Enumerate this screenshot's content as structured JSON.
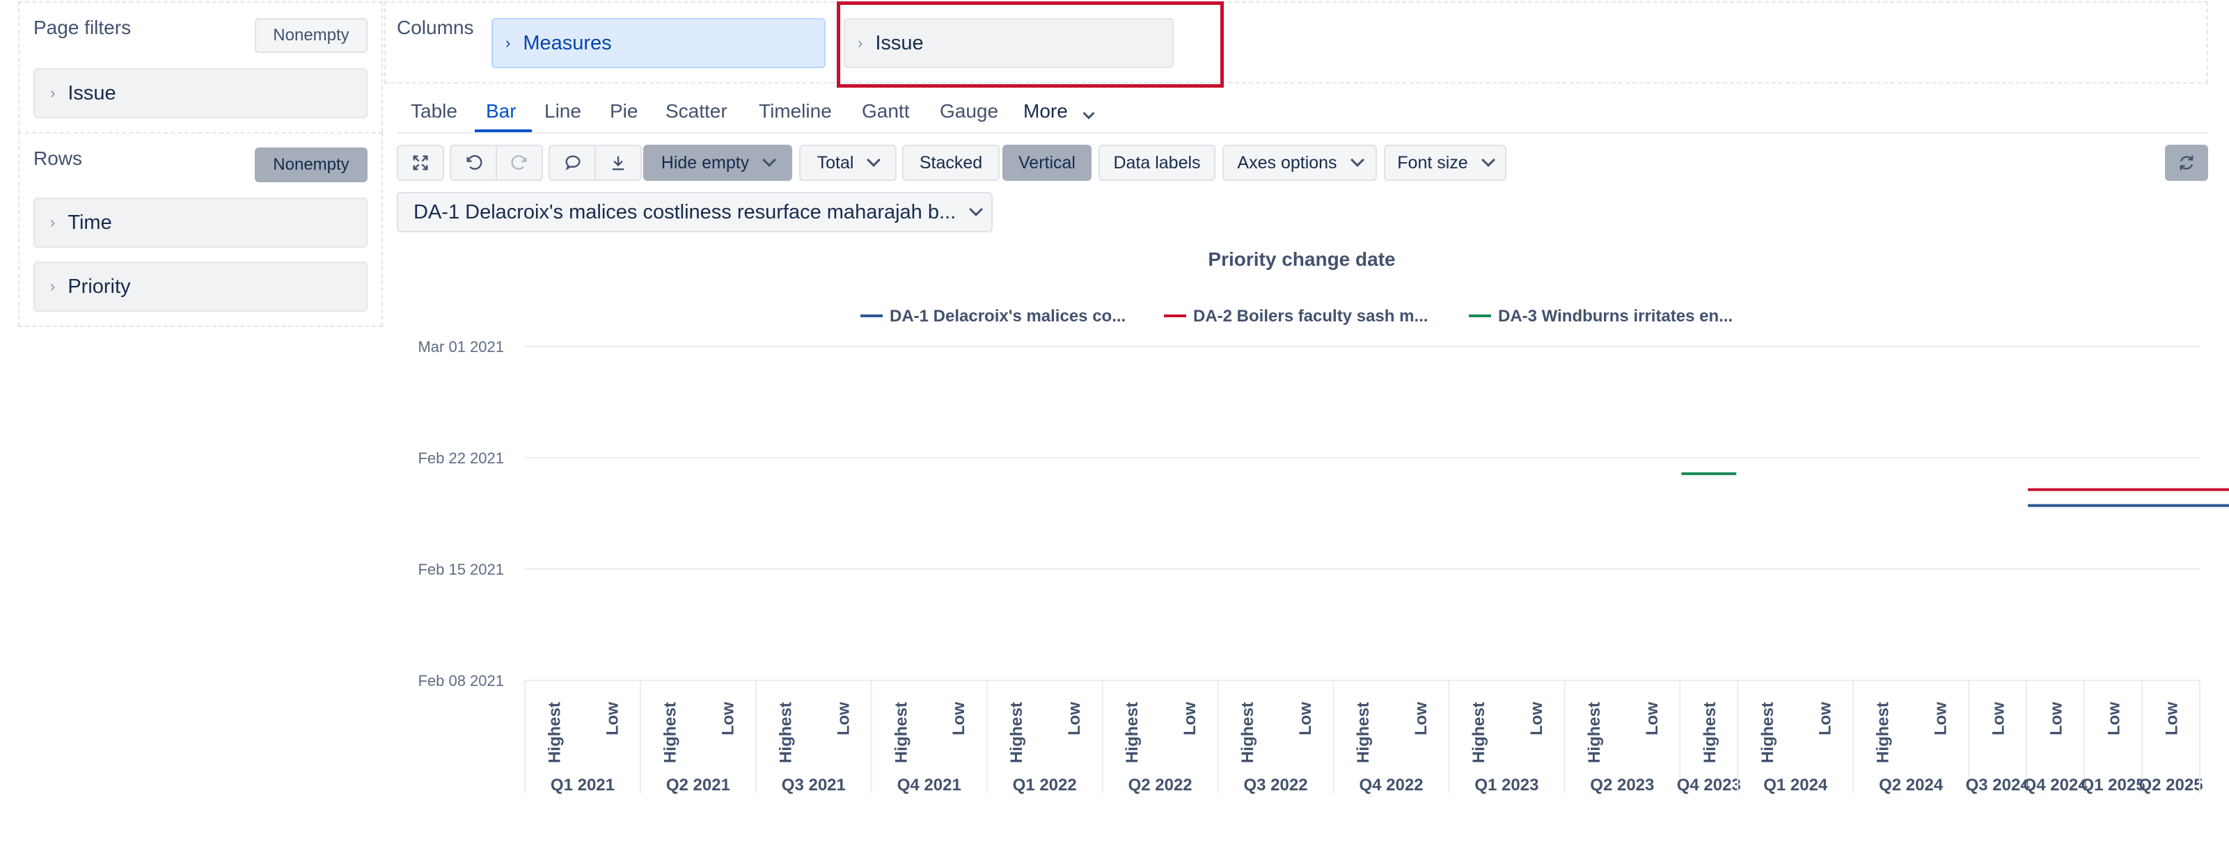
{
  "left_panel": {
    "page_filters": {
      "title": "Page filters",
      "nonempty_label": "Nonempty",
      "items": [
        "Issue"
      ]
    },
    "rows": {
      "title": "Rows",
      "nonempty_label": "Nonempty",
      "items": [
        "Time",
        "Priority"
      ]
    }
  },
  "columns": {
    "title": "Columns",
    "chips": [
      "Measures",
      "Issue"
    ]
  },
  "tabs": [
    {
      "label": "Table",
      "active": false
    },
    {
      "label": "Bar",
      "active": true
    },
    {
      "label": "Line",
      "active": false
    },
    {
      "label": "Pie",
      "active": false
    },
    {
      "label": "Scatter",
      "active": false
    },
    {
      "label": "Timeline",
      "active": false
    },
    {
      "label": "Gantt",
      "active": false
    },
    {
      "label": "Gauge",
      "active": false
    }
  ],
  "more_label": "More",
  "toolbar": {
    "hide_empty": "Hide empty",
    "total": "Total",
    "stacked": "Stacked",
    "vertical": "Vertical",
    "data_labels": "Data labels",
    "axes_options": "Axes options",
    "font_size": "Font size"
  },
  "issue_selector": "DA-1 Delacroix's malices costliness resurface maharajah b...",
  "colors": {
    "accent": "#0052cc",
    "highlight": "#c8102e",
    "blue": "#2b5797",
    "red": "#c8102e",
    "green": "#1a8a5a"
  },
  "chart_data": {
    "type": "line",
    "title": "Priority change date",
    "legend_placement": "top",
    "y_ticks": [
      "Mar 01 2021",
      "Feb 22 2021",
      "Feb 15 2021",
      "Feb 08 2021"
    ],
    "ylim": [
      "2021-02-08",
      "2021-03-01"
    ],
    "quarters": [
      {
        "label": "Q1 2021",
        "priorities": [
          "Highest",
          "Low"
        ]
      },
      {
        "label": "Q2 2021",
        "priorities": [
          "Highest",
          "Low"
        ]
      },
      {
        "label": "Q3 2021",
        "priorities": [
          "Highest",
          "Low"
        ]
      },
      {
        "label": "Q4 2021",
        "priorities": [
          "Highest",
          "Low"
        ]
      },
      {
        "label": "Q1 2022",
        "priorities": [
          "Highest",
          "Low"
        ]
      },
      {
        "label": "Q2 2022",
        "priorities": [
          "Highest",
          "Low"
        ]
      },
      {
        "label": "Q3 2022",
        "priorities": [
          "Highest",
          "Low"
        ]
      },
      {
        "label": "Q4 2022",
        "priorities": [
          "Highest",
          "Low"
        ]
      },
      {
        "label": "Q1 2023",
        "priorities": [
          "Highest",
          "Low"
        ]
      },
      {
        "label": "Q2 2023",
        "priorities": [
          "Highest",
          "Low"
        ]
      },
      {
        "label": "Q4 2023",
        "priorities": [
          "Highest"
        ]
      },
      {
        "label": "Q1 2024",
        "priorities": [
          "Highest",
          "Low"
        ]
      },
      {
        "label": "Q2 2024",
        "priorities": [
          "Highest",
          "Low"
        ]
      },
      {
        "label": "Q3 2024",
        "priorities": [
          "Low"
        ]
      },
      {
        "label": "Q4 2024",
        "priorities": [
          "Low"
        ]
      },
      {
        "label": "Q1 2025",
        "priorities": [
          "Low"
        ]
      },
      {
        "label": "Q2 2025",
        "priorities": [
          "Low"
        ]
      }
    ],
    "series": [
      {
        "name": "DA-1 Delacroix's malices co...",
        "color": "#2b5797",
        "points": [
          {
            "category": 26,
            "date": "2021-02-19"
          },
          {
            "category": 27,
            "date": "2021-02-19"
          },
          {
            "category": 28,
            "date": "2021-02-19"
          },
          {
            "category": 29,
            "date": "2021-02-19"
          }
        ]
      },
      {
        "name": "DA-2 Boilers faculty sash m...",
        "color": "#c8102e",
        "points": [
          {
            "category": 26,
            "date": "2021-02-20"
          },
          {
            "category": 27,
            "date": "2021-02-20"
          },
          {
            "category": 28,
            "date": "2021-02-20"
          },
          {
            "category": 29,
            "date": "2021-02-20"
          }
        ]
      },
      {
        "name": "DA-3 Windburns irritates en...",
        "color": "#1a8a5a",
        "points": [
          {
            "category": 20,
            "date": "2021-02-21"
          }
        ]
      }
    ]
  }
}
